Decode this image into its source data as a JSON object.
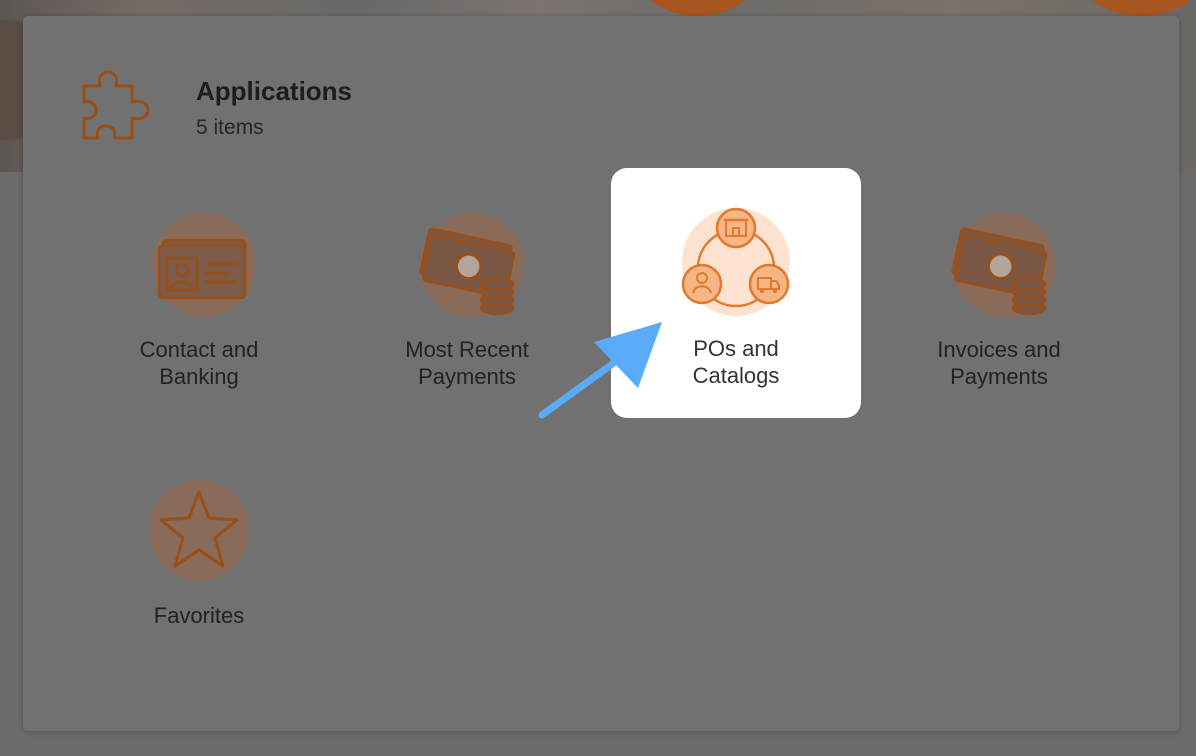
{
  "header": {
    "title": "Applications",
    "count": "5 items",
    "icon": "puzzle-icon"
  },
  "tiles": [
    {
      "label": "Contact and\nBanking",
      "icon": "id-card-icon"
    },
    {
      "label": "Most Recent\nPayments",
      "icon": "money-coins-icon"
    },
    {
      "label": "POs and\nCatalogs",
      "icon": "store-user-truck-icon",
      "highlighted": true
    },
    {
      "label": "Invoices and\nPayments",
      "icon": "money-coins-icon"
    },
    {
      "label": "Favorites",
      "icon": "star-icon"
    }
  ],
  "colors": {
    "accent": "#e07a2f",
    "accent_soft": "#f9c9a3",
    "pointer_arrow": "#5aabf7",
    "overlay": "#717171"
  }
}
